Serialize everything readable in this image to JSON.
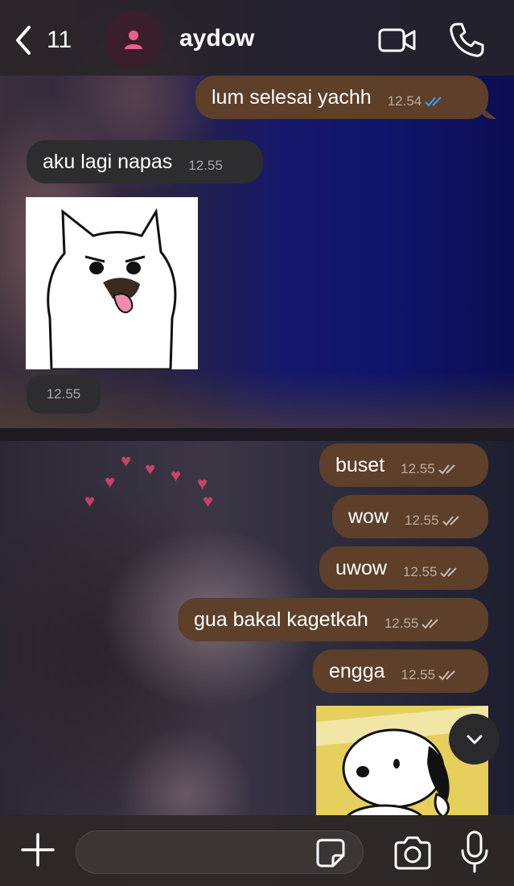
{
  "header": {
    "back_count": "11",
    "contact_name": "aydow"
  },
  "colors": {
    "outgoing_bubble": "#5d3f2a",
    "incoming_bubble": "#2d2d2f",
    "read_tick": "#4a9cf0",
    "delivered_tick": "#c7bdb5",
    "avatar_icon": "#e8618c"
  },
  "messages": [
    {
      "direction": "out",
      "text": "lum selesai yachh",
      "time": "12.54",
      "status": "read"
    },
    {
      "direction": "in",
      "text": "aku lagi napas",
      "time": "12.55"
    },
    {
      "direction": "in",
      "type": "sticker",
      "sticker": "white-cat-sticker",
      "time": "12.55"
    },
    {
      "direction": "out",
      "text": "buset",
      "time": "12.55",
      "status": "delivered"
    },
    {
      "direction": "out",
      "text": "wow",
      "time": "12.55",
      "status": "delivered"
    },
    {
      "direction": "out",
      "text": "uwow",
      "time": "12.55",
      "status": "delivered"
    },
    {
      "direction": "out",
      "text": "gua bakal kagetkah",
      "time": "12.55",
      "status": "delivered"
    },
    {
      "direction": "out",
      "text": "engga",
      "time": "12.55",
      "status": "delivered"
    },
    {
      "direction": "out",
      "type": "sticker",
      "sticker": "snoopy-sticker"
    }
  ],
  "icons": {
    "back": "chevron-left-icon",
    "avatar": "person-icon",
    "video": "video-camera-icon",
    "call": "phone-icon",
    "scroll": "chevron-down-icon",
    "attach": "plus-icon",
    "sticker": "sticker-icon",
    "camera": "camera-icon",
    "mic": "microphone-icon"
  },
  "input": {
    "value": "",
    "placeholder": ""
  }
}
